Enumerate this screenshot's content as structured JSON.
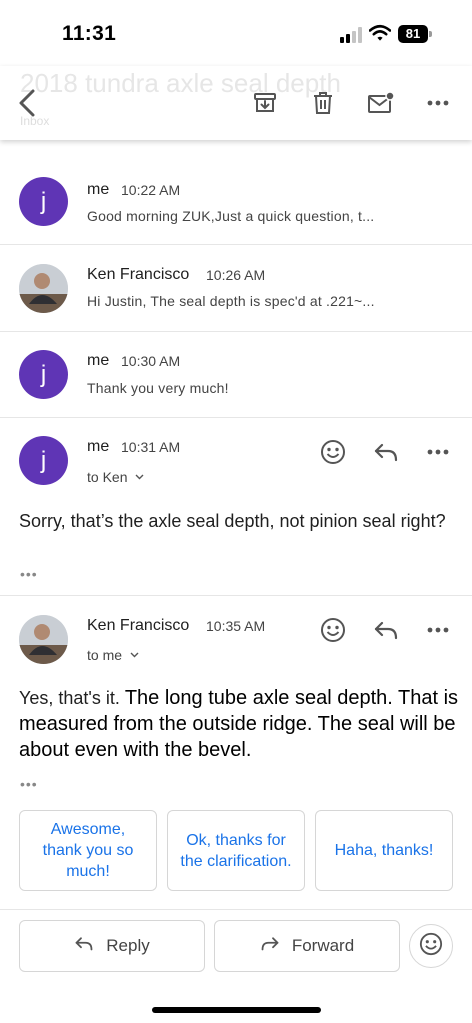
{
  "status_bar": {
    "time": "11:31",
    "battery": "81"
  },
  "header": {
    "subject": "2018 tundra axle seal depth",
    "label": "Inbox",
    "icons": [
      "back-icon",
      "archive-icon",
      "delete-icon",
      "mark-unread-icon",
      "more-icon"
    ]
  },
  "colors": {
    "accent": "#1a73e8",
    "avatar": "#5f35b5",
    "text": "#1f1f1f",
    "secondary": "#444444"
  },
  "messages": [
    {
      "sender": "me",
      "time": "10:22 AM",
      "avatar_letter": "j",
      "snippet": "Good morning ZUK,Just a quick question, t..."
    },
    {
      "sender": "Ken Francisco",
      "time": "10:26 AM",
      "snippet": "Hi Justin, The seal depth is spec'd at .221~..."
    },
    {
      "sender": "me",
      "time": "10:30 AM",
      "avatar_letter": "j",
      "snippet": "Thank you very much!"
    },
    {
      "sender": "me",
      "time": "10:31 AM",
      "avatar_letter": "j",
      "to": "to Ken",
      "body": "Sorry, that’s the axle seal depth, not pinion seal right?",
      "quoted": "•••"
    },
    {
      "sender": "Ken Francisco",
      "time": "10:35 AM",
      "to": "to me",
      "body_start": "Yes, that's it. ",
      "body_rest": "The long tube axle seal depth. That is measured from the outside ridge. The seal will be about even with the bevel.",
      "quoted": "•••"
    }
  ],
  "smart_replies": [
    "Awesome, thank you so much!",
    "Ok, thanks for the clarification.",
    "Haha, thanks!"
  ],
  "actions": {
    "reply": "Reply",
    "forward": "Forward"
  }
}
